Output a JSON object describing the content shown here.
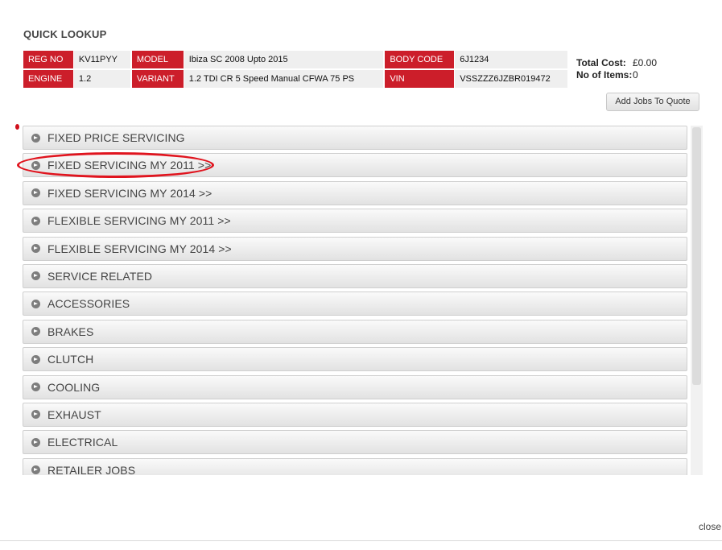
{
  "title": "QUICK LOOKUP",
  "vehicle": {
    "reg_no_label": "REG NO",
    "reg_no": "KV11PYY",
    "model_label": "MODEL",
    "model": "Ibiza SC 2008 Upto 2015",
    "body_code_label": "BODY CODE",
    "body_code": "6J1234",
    "engine_label": "ENGINE",
    "engine": "1.2",
    "variant_label": "VARIANT",
    "variant": "1.2 TDI CR 5 Speed Manual CFWA 75 PS",
    "vin_label": "VIN",
    "vin": "VSSZZZ6JZBR019472"
  },
  "totals": {
    "total_cost_label": "Total Cost:",
    "total_cost": "£0.00",
    "items_label": "No of Items:",
    "items": "0"
  },
  "add_jobs_label": "Add Jobs To Quote",
  "categories": [
    "FIXED PRICE SERVICING",
    "FIXED SERVICING MY 2011 >>",
    "FIXED SERVICING MY 2014 >>",
    "FLEXIBLE SERVICING MY 2011 >>",
    "FLEXIBLE SERVICING MY 2014 >>",
    "SERVICE RELATED",
    "ACCESSORIES",
    "BRAKES",
    "CLUTCH",
    "COOLING",
    "EXHAUST",
    "ELECTRICAL",
    "RETAILER JOBS"
  ],
  "close_label": "close",
  "colors": {
    "accent_red": "#cc1e2a",
    "highlight_red": "#e0141e"
  }
}
